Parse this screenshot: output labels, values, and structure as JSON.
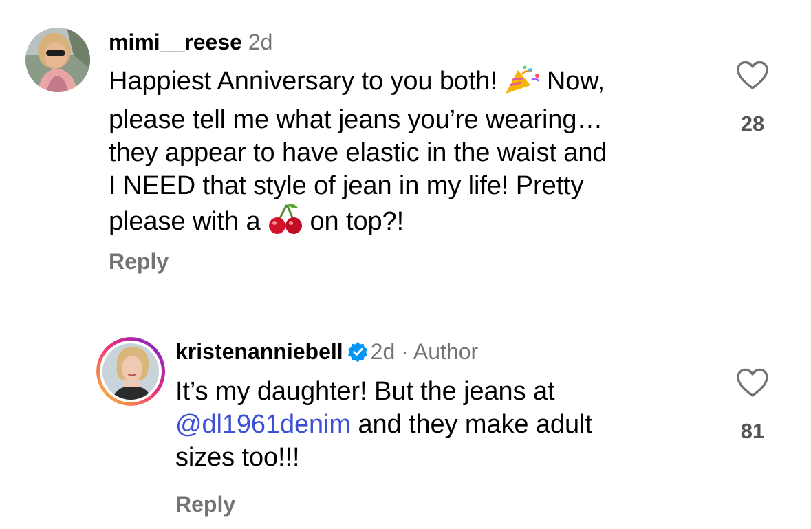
{
  "comments": [
    {
      "username": "mimi__reese",
      "time": "2d",
      "text_line1_a": "Happiest Anniversary to you both!",
      "text_line1_b": "Now,",
      "text_line2": "please tell me what jeans you’re wearing…",
      "text_line3": "they appear to have elastic in the waist and",
      "text_line4": "I NEED that style of jean in my life! Pretty",
      "text_line5_a": "please with a",
      "text_line5_b": "on top?!",
      "emoji1": "party-popper-icon",
      "emoji2": "cherry-icon",
      "reply_label": "Reply",
      "likes": "28"
    },
    {
      "username": "kristenanniebell",
      "time": "2d",
      "separator": "·",
      "author_label": "Author",
      "text_line1": "It’s my daughter! But the jeans at",
      "mention": "@dl1961denim",
      "text_line2_rest": " and they make adult",
      "text_line3": "sizes too!!!",
      "reply_label": "Reply",
      "likes": "81",
      "verified_icon": "verified-badge-icon"
    }
  ],
  "colors": {
    "secondary_text": "#737373",
    "mention": "#3d4fd6",
    "verified": "#0095f6",
    "story_ring_start": "#f9ce34",
    "story_ring_mid": "#ee2a7b",
    "story_ring_end": "#6228d7"
  }
}
